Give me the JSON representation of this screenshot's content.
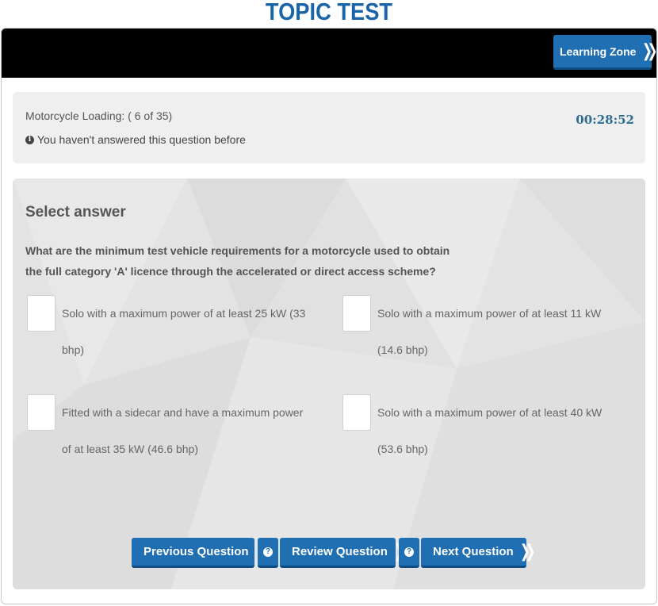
{
  "header": {
    "title": "TOPIC TEST"
  },
  "topbar": {
    "learning_zone_label": "Learning Zone"
  },
  "status": {
    "progress": "Motorcycle Loading: ( 6 of 35)",
    "answered_note": "You haven't answered this question before",
    "timer": "00:28:52"
  },
  "question": {
    "heading": "Select answer",
    "text": "What are the minimum test vehicle requirements for a motorcycle used to obtain the full category 'A' licence through the accelerated or direct access scheme?",
    "options": [
      {
        "label": "Solo with a maximum power of at least 25 kW (33 bhp)"
      },
      {
        "label": "Solo with a maximum power of at least 11 kW (14.6 bhp)"
      },
      {
        "label": "Fitted with a sidecar and have a maximum power of at least 35 kW (46.6 bhp)"
      },
      {
        "label": "Solo with a maximum power of at least 40 kW (53.6 bhp)"
      }
    ]
  },
  "nav": {
    "previous_label": "Previous Question",
    "review_label": "Review Question",
    "next_label": "Next Question"
  },
  "colors": {
    "title": "#1a64a8",
    "button": "#1f6fb2",
    "timer": "#2c6d93",
    "topbar": "#000000"
  }
}
